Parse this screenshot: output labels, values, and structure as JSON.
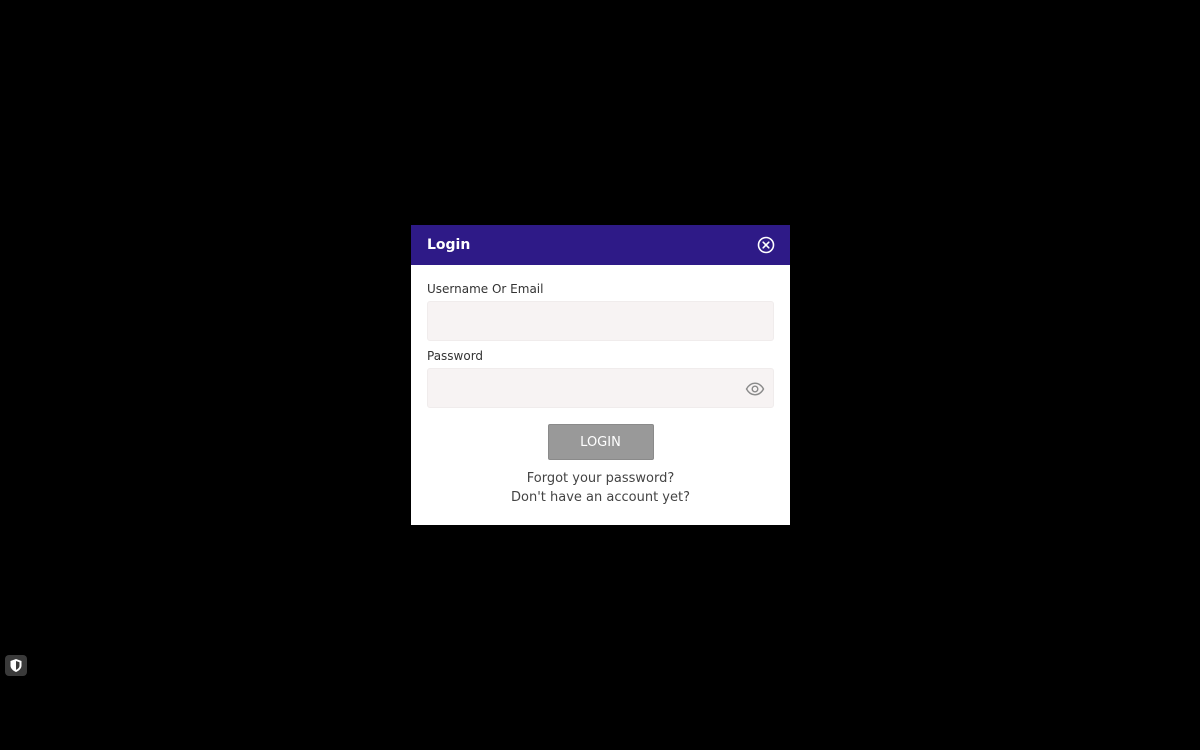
{
  "modal": {
    "title": "Login",
    "username_label": "Username Or Email",
    "username_value": "",
    "password_label": "Password",
    "password_value": "",
    "login_label": "LOGIN",
    "forgot_label": "Forgot your password?",
    "signup_label": "Don't have an account yet?",
    "close_icon": "close-circle-icon",
    "eye_icon": "eye-icon"
  },
  "colors": {
    "header_bg": "#2e1a87",
    "button_bg": "#999999",
    "field_bg": "#f7f3f3",
    "backdrop": "#000000"
  },
  "badge": {
    "icon": "shield-icon"
  }
}
